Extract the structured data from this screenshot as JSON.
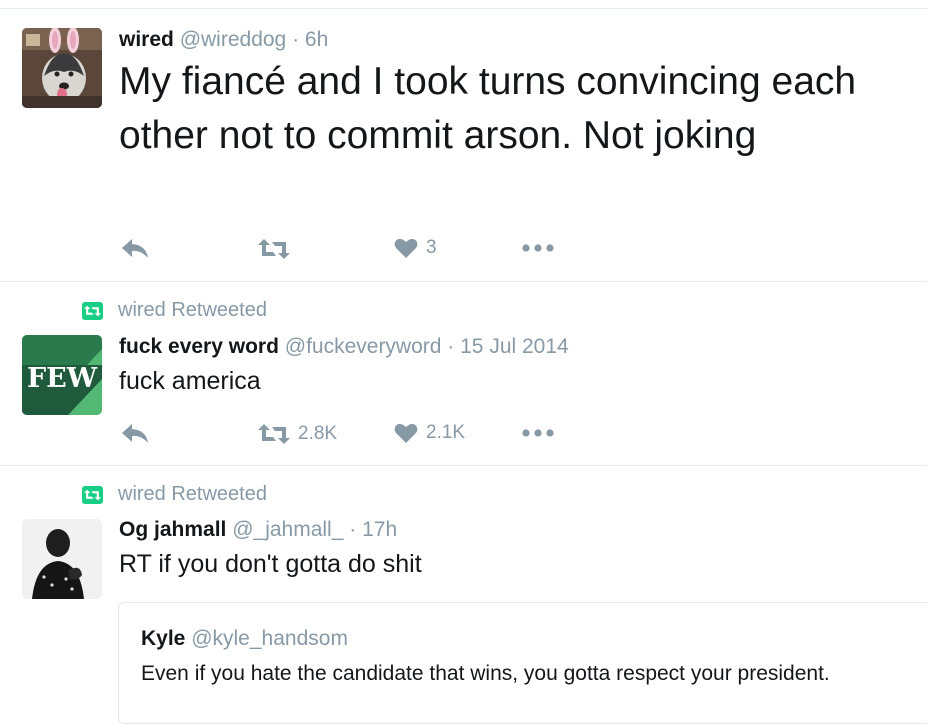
{
  "tweets": [
    {
      "name": "wired",
      "handle": "@wireddog",
      "time": "· 6h",
      "text": "My fiancé and I took turns convincing each other not to commit arson.  Not joking",
      "actions": {
        "retweets": "",
        "likes": "3"
      },
      "avatar_icon": "husky-bunny-ears-photo"
    },
    {
      "context": "wired Retweeted",
      "name": "fuck every word",
      "handle": "@fuckeveryword",
      "time": "· 15 Jul 2014",
      "text": "fuck america",
      "avatar_text": "FEW",
      "actions": {
        "retweets": "2.8K",
        "likes": "2.1K"
      }
    },
    {
      "context": "wired Retweeted",
      "name": "Og jahmall",
      "handle": "@_jahmall_",
      "time": "· 17h",
      "text": "RT if you don't gotta do shit",
      "avatar_icon": "person-photo",
      "quote": {
        "name": "Kyle",
        "handle": "@kyle_handsom",
        "text": "Even if you hate the candidate that wins, you gotta respect your president."
      }
    }
  ],
  "colors": {
    "text": "#14171a",
    "muted": "#8899a6",
    "retweet_green": "#19cf86",
    "border": "#e6ecf0",
    "few_dark": "#1f5a3c",
    "few_light": "#52b874"
  }
}
